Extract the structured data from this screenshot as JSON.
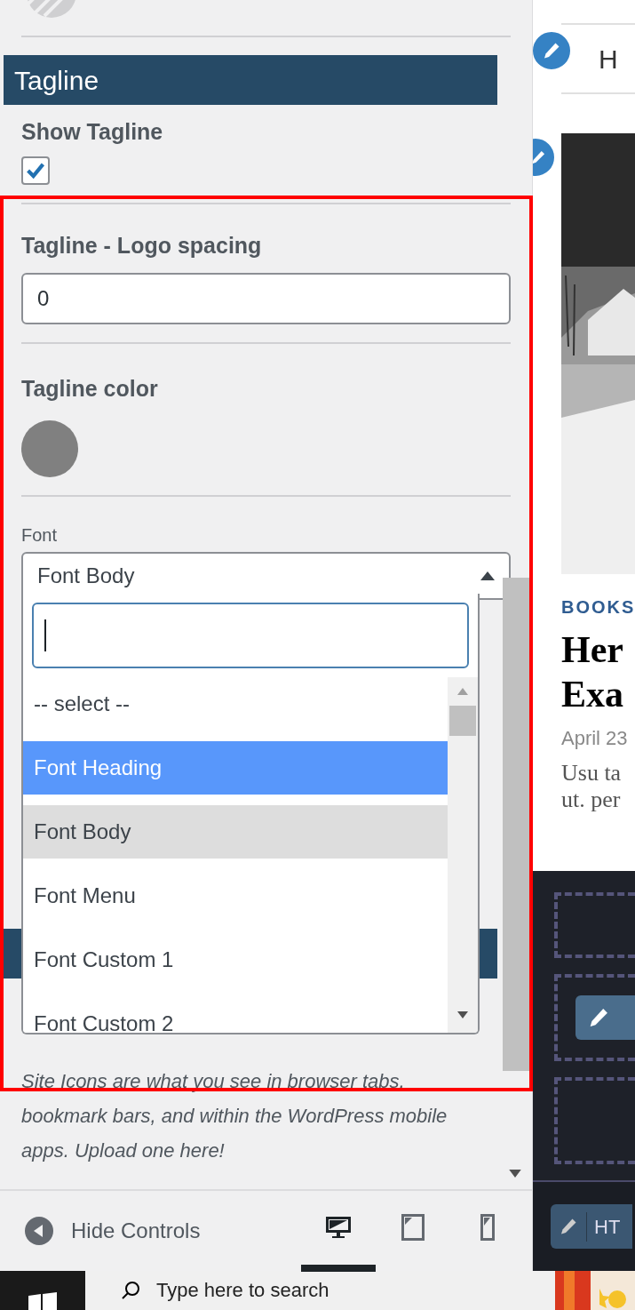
{
  "panel": {
    "section_title": "Tagline",
    "show_tagline": {
      "label": "Show Tagline",
      "checked": true
    },
    "spacing": {
      "label": "Tagline - Logo spacing",
      "value": "0"
    },
    "color": {
      "label": "Tagline color",
      "color": "#808080"
    },
    "font": {
      "label": "Font",
      "value": "Font Body",
      "open": true
    },
    "dropdown": {
      "options": [
        {
          "label": "-- select --",
          "selected": false,
          "current": false
        },
        {
          "label": "Font Heading",
          "selected": true,
          "current": false
        },
        {
          "label": "Font Body",
          "selected": false,
          "current": true
        },
        {
          "label": "Font Menu",
          "selected": false,
          "current": false
        },
        {
          "label": "Font Custom 1",
          "selected": false,
          "current": false
        },
        {
          "label": "Font Custom 2",
          "selected": false,
          "current": false
        }
      ]
    },
    "site_icon_note": "Site Icons are what you see in browser tabs, bookmark bars, and within the WordPress mobile apps. Upload one here!"
  },
  "footer": {
    "hide_controls": "Hide Controls",
    "devices": [
      {
        "kind": "desktop",
        "selected": true
      },
      {
        "kind": "tablet",
        "selected": false
      },
      {
        "kind": "mobile",
        "selected": false
      }
    ]
  },
  "preview": {
    "menu_item": "H",
    "category": "BOOKS",
    "title_lines": [
      "Her",
      "Exa"
    ],
    "date": "April 23",
    "excerpt_lines": [
      "Usu ta",
      "ut. per"
    ],
    "html_button": "HT"
  },
  "taskbar": {
    "search_placeholder": "Type here to search"
  }
}
